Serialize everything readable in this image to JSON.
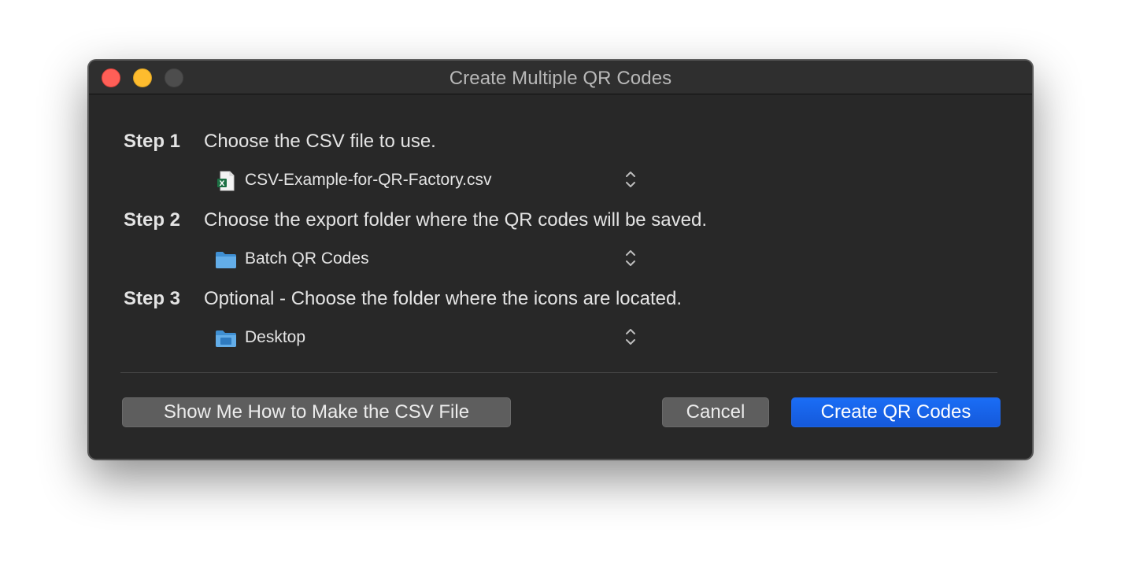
{
  "window": {
    "title": "Create Multiple QR Codes"
  },
  "steps": [
    {
      "label": "Step 1",
      "text": "Choose the CSV file to use.",
      "picker": {
        "value": "CSV-Example-for-QR-Factory.csv",
        "icon": "csv-file-icon"
      }
    },
    {
      "label": "Step 2",
      "text": "Choose the export folder where the QR codes will be saved.",
      "picker": {
        "value": "Batch QR Codes",
        "icon": "folder-icon"
      }
    },
    {
      "label": "Step 3",
      "text": "Optional - Choose the folder where the icons are located.",
      "picker": {
        "value": "Desktop",
        "icon": "desktop-folder-icon"
      }
    }
  ],
  "buttons": {
    "show_me": "Show Me How to Make the CSV File",
    "cancel": "Cancel",
    "create": "Create QR Codes"
  },
  "colors": {
    "window_bg": "#282828",
    "accent": "#1a6df5",
    "close": "#ff5f57",
    "minimize": "#febc2e"
  }
}
